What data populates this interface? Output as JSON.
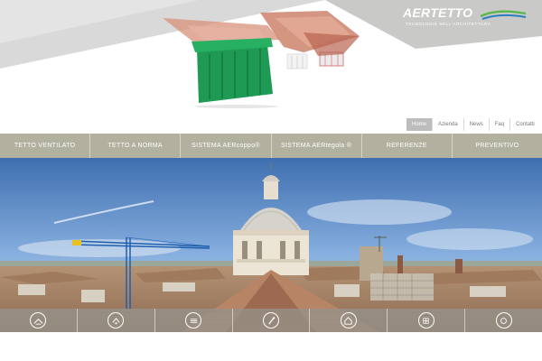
{
  "brand": {
    "logo_text": "AERTETTO",
    "tagline": "TECNOLOGIE NELL'ARCHITETTURA",
    "colors": {
      "nav_bg": "#b2b09f",
      "swoosh_green": "#55b848",
      "swoosh_blue": "#2a7fc1"
    }
  },
  "toplinks": [
    {
      "label": "Home",
      "active": true
    },
    {
      "label": "Azienda",
      "active": false
    },
    {
      "label": "News",
      "active": false
    },
    {
      "label": "Faq",
      "active": false
    },
    {
      "label": "Contatti",
      "active": false
    }
  ],
  "mainnav": [
    {
      "label": "TETTO VENTILATO"
    },
    {
      "label": "TETTO A NORMA"
    },
    {
      "label": "SISTEMA AERcoppo®"
    },
    {
      "label": "SISTEMA AERtegola ®"
    },
    {
      "label": "REFERENZE"
    },
    {
      "label": "PREVENTIVO"
    }
  ],
  "iconbar": [
    {
      "icon": "roof-ventilation-icon"
    },
    {
      "icon": "tile-fixing-icon"
    },
    {
      "icon": "roof-layers-icon"
    },
    {
      "icon": "tool-icon"
    },
    {
      "icon": "house-icon"
    },
    {
      "icon": "grid-icon"
    },
    {
      "icon": "circle-arrow-icon"
    }
  ]
}
